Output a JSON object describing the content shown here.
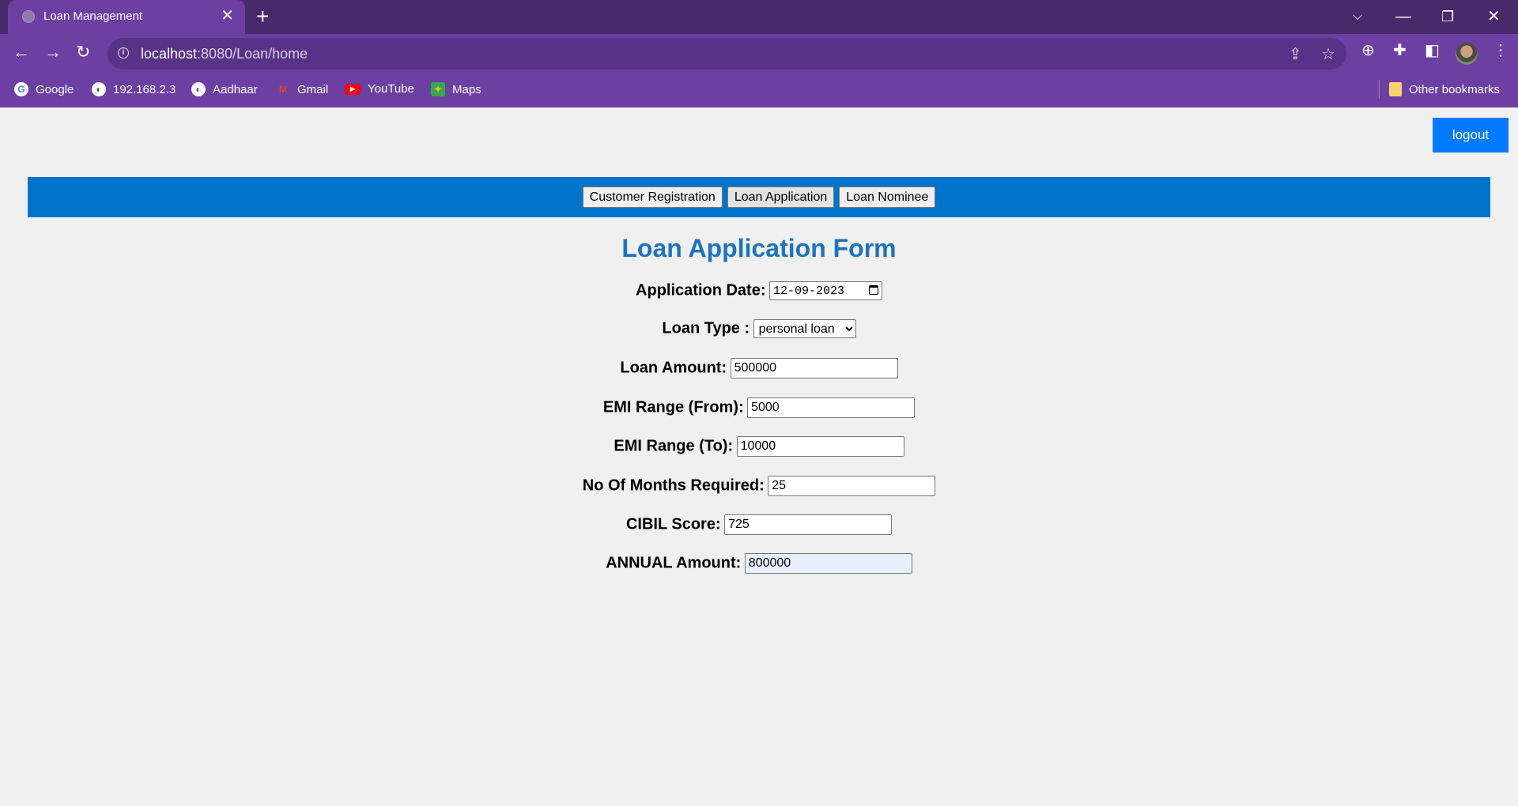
{
  "browser": {
    "tab_title": "Loan Management",
    "new_tab_label": "+",
    "url_host": "localhost",
    "url_path": ":8080/Loan/home",
    "bookmarks": [
      {
        "label": "Google",
        "icon": "google-icon"
      },
      {
        "label": "192.168.2.3",
        "icon": "globe-icon"
      },
      {
        "label": "Aadhaar",
        "icon": "globe-icon"
      },
      {
        "label": "Gmail",
        "icon": "gmail-icon"
      },
      {
        "label": "YouTube",
        "icon": "youtube-icon"
      },
      {
        "label": "Maps",
        "icon": "maps-icon"
      }
    ],
    "other_bookmarks": "Other bookmarks"
  },
  "page": {
    "logout_label": "logout",
    "nav": [
      {
        "label": "Customer Registration"
      },
      {
        "label": "Loan Application"
      },
      {
        "label": "Loan Nominee"
      }
    ],
    "form_title": "Loan Application Form",
    "fields": {
      "application_date": {
        "label": "Application Date:",
        "value": "12-09-2023"
      },
      "loan_type": {
        "label": "Loan Type :",
        "value": "personal loan"
      },
      "loan_amount": {
        "label": "Loan Amount:",
        "value": "500000"
      },
      "emi_from": {
        "label": "EMI Range (From):",
        "value": "5000"
      },
      "emi_to": {
        "label": "EMI Range (To):",
        "value": "10000"
      },
      "months": {
        "label": "No Of Months Required:",
        "value": "25"
      },
      "cibil": {
        "label": "CIBIL Score:",
        "value": "725"
      },
      "annual": {
        "label": "ANNUAL Amount:",
        "value": "800000"
      }
    }
  },
  "colors": {
    "chrome_dark": "#482a6b",
    "chrome_main": "#6c3fa3",
    "nav_band": "#0074cc",
    "logout_button": "#007bff",
    "form_title": "#1e73be"
  }
}
